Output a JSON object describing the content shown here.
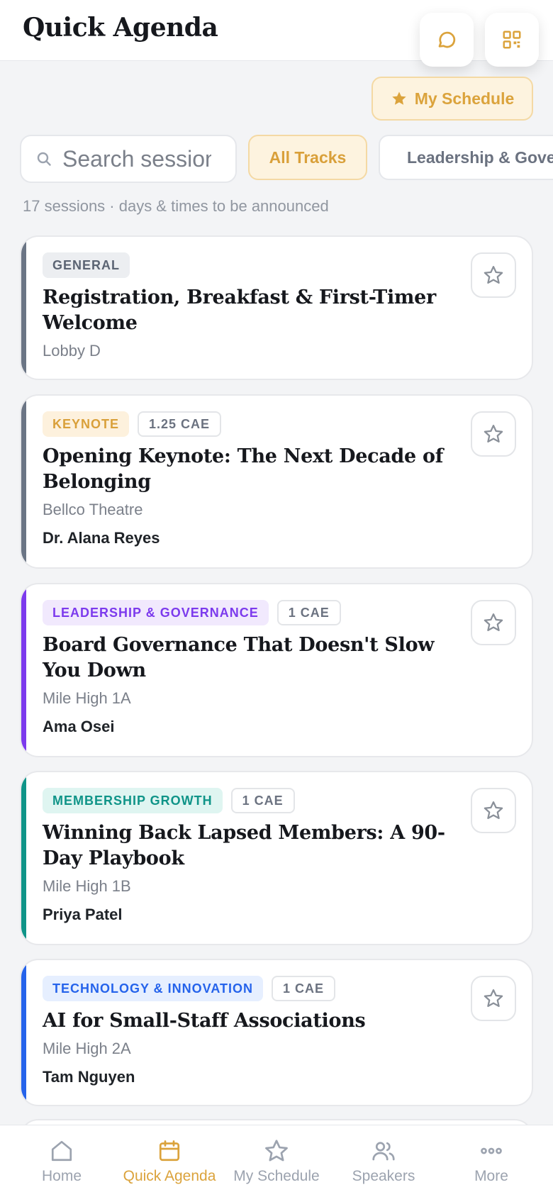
{
  "header": {
    "title": "Quick Agenda",
    "chat_icon": "chat-bubble-icon",
    "qr_icon": "qr-code-icon"
  },
  "my_schedule_button": {
    "label": "My Schedule",
    "icon": "star-icon"
  },
  "search": {
    "placeholder": "Search sessions"
  },
  "filters": {
    "all": "All Tracks",
    "leadership": "Leadership & Governance"
  },
  "meta": "17 sessions · days & times to be announced",
  "colors": {
    "accent": "#dba33c",
    "general": "#6b7585",
    "leadership": "#7c3aed",
    "membership": "#0f9488",
    "technology": "#2563eb"
  },
  "sessions": [
    {
      "track": "GENERAL",
      "title": "Registration, Breakfast & First-Timer Welcome",
      "room": "Lobby D"
    },
    {
      "track": "KEYNOTE",
      "cae": "1.25 CAE",
      "title": "Opening Keynote: The Next Decade of Belonging",
      "room": "Bellco Theatre",
      "speaker": "Dr. Alana Reyes"
    },
    {
      "track": "LEADERSHIP & GOVERNANCE",
      "cae": "1 CAE",
      "title": "Board Governance That Doesn't Slow You Down",
      "room": "Mile High 1A",
      "speaker": "Ama Osei"
    },
    {
      "track": "MEMBERSHIP GROWTH",
      "cae": "1 CAE",
      "title": "Winning Back Lapsed Members: A 90-Day Playbook",
      "room": "Mile High 1B",
      "speaker": "Priya Patel"
    },
    {
      "track": "TECHNOLOGY & INNOVATION",
      "cae": "1 CAE",
      "title": "AI for Small-Staff Associations",
      "room": "Mile High 2A",
      "speaker": "Tam Nguyen"
    }
  ],
  "tabbar": [
    {
      "label": "Home",
      "icon": "home-icon"
    },
    {
      "label": "Quick Agenda",
      "icon": "calendar-icon",
      "active": true
    },
    {
      "label": "My Schedule",
      "icon": "star-icon"
    },
    {
      "label": "Speakers",
      "icon": "people-icon"
    },
    {
      "label": "More",
      "icon": "more-icon"
    }
  ]
}
